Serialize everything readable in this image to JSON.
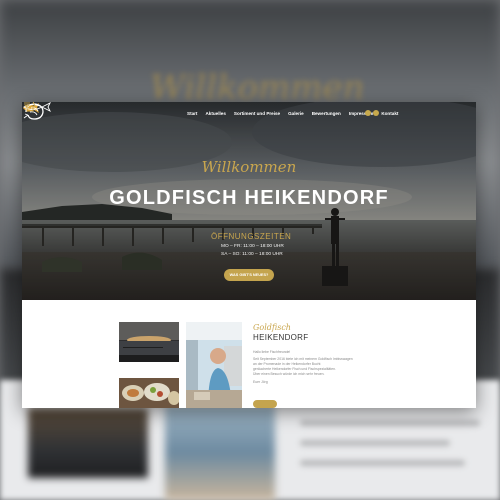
{
  "hero": {
    "welcome": "Willkommen",
    "title": "GOLDFISCH HEIKENDORF",
    "hours_title": "ÖFFNUNGSZEITEN",
    "hours_line1": "MO – FR: 11:00 – 18:00 UHR",
    "hours_line2": "SA – SO: 11:00 – 18:00 UHR",
    "cta_label": "WAS GIBT'S NEUES?"
  },
  "nav": {
    "items": [
      "Start",
      "Aktuelles",
      "Sortiment und Preise",
      "Galerie",
      "Bewertungen",
      "Impressum",
      "Kontakt"
    ]
  },
  "content": {
    "script_title": "Goldfisch",
    "brand": "HEIKENDORF",
    "lines": [
      "Hallo liebe Fischfreunde!",
      "Seit September 2016 biete ich mit meinem Goldfisch Imbisswagen",
      "an der Promenade in der Heikendorfer Bucht",
      "geräucherte Heikendorfer Fisch und Fischspezialitäten.",
      "Über einen Besuch würde ich mich sehr freuen.",
      "Euer Jörg"
    ]
  },
  "colors": {
    "accent": "#c9a64e",
    "button": "#c4a44e"
  }
}
